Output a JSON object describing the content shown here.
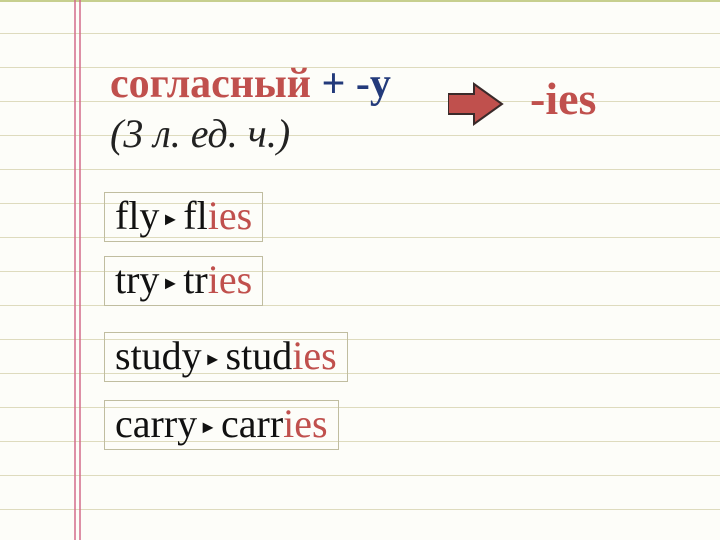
{
  "heading": {
    "consonant": "согласный",
    "plus": " + ",
    "suffix": "-y",
    "subtitle": "(3 л. ед. ч.)"
  },
  "result": {
    "text": "-ies"
  },
  "arrow_icon": "arrow-right",
  "examples": [
    {
      "base_stem": "fly",
      "tri": "►",
      "result_stem": "fl",
      "result_suffix": "ies"
    },
    {
      "base_stem": "try",
      "tri": " ► ",
      "result_stem": "tr",
      "result_suffix": "ies"
    },
    {
      "base_stem": "study",
      "tri": " ► ",
      "result_stem": "stud",
      "result_suffix": "ies"
    },
    {
      "base_stem": "carry",
      "tri": " ► ",
      "result_stem": "carr",
      "result_suffix": "ies"
    }
  ]
}
